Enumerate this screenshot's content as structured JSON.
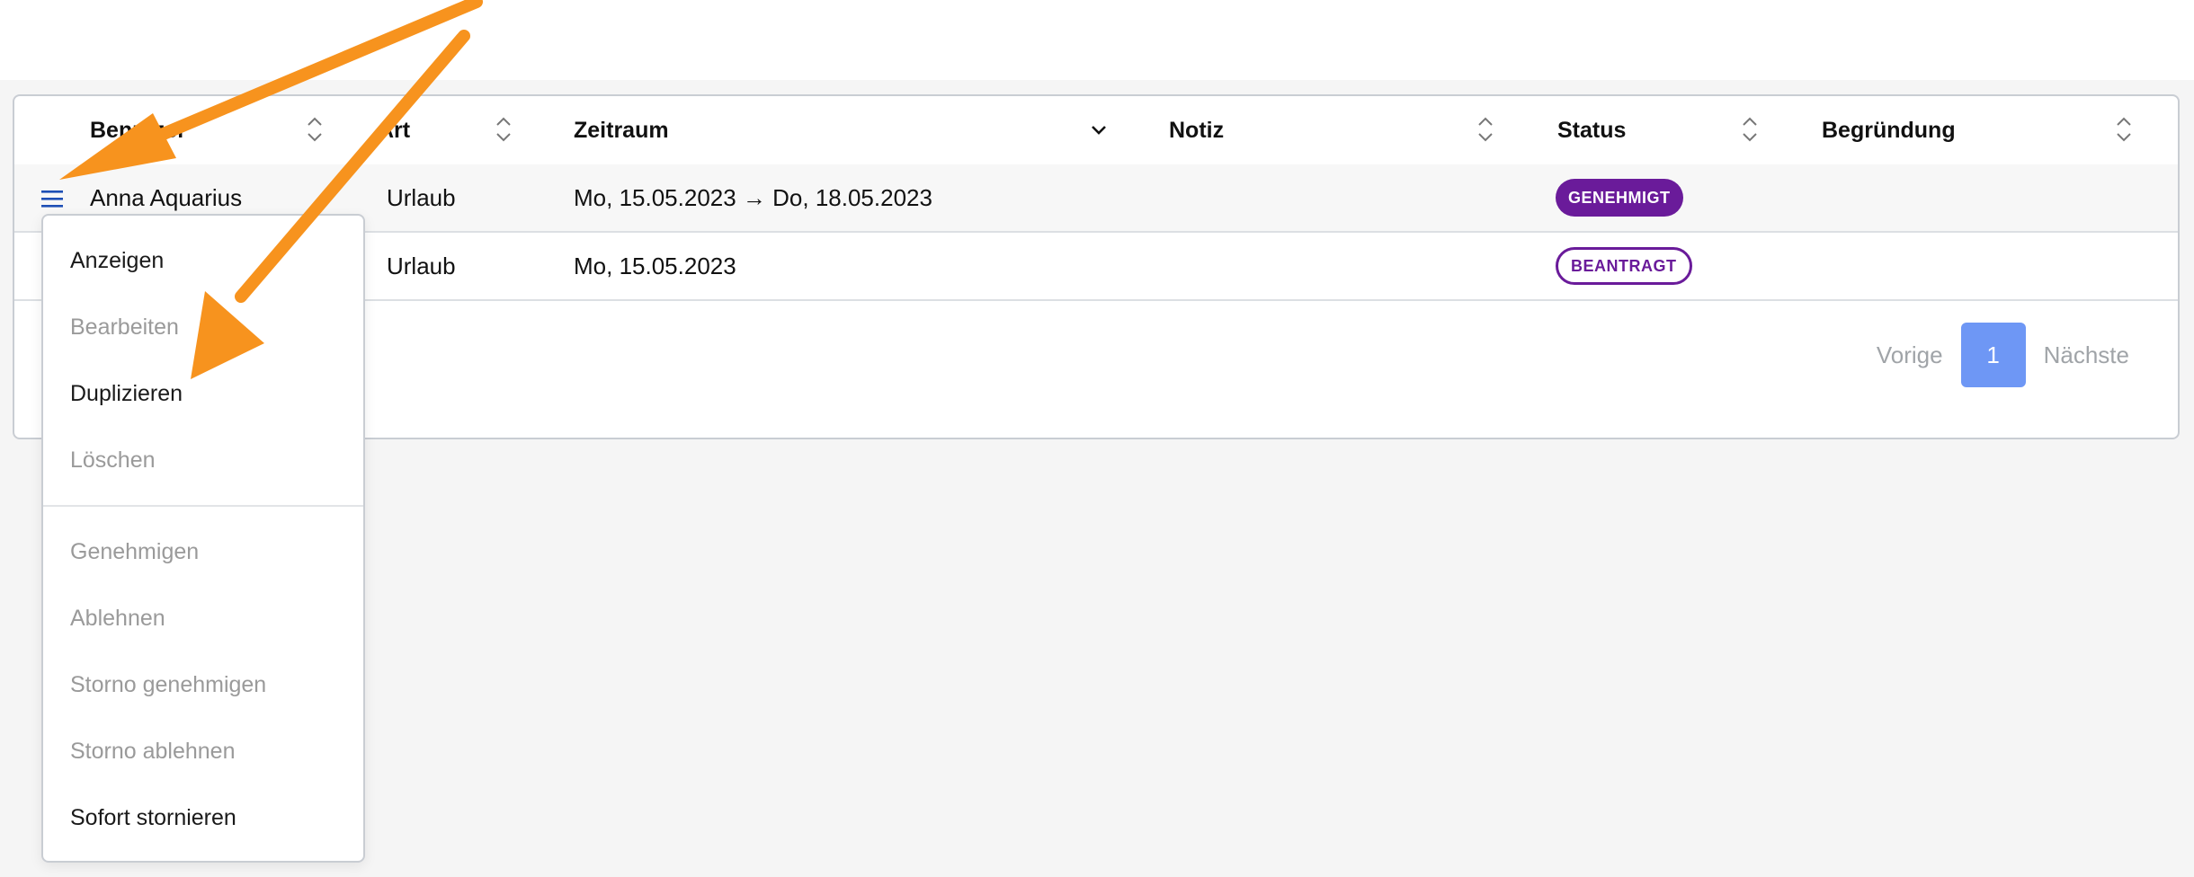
{
  "table": {
    "columns": [
      {
        "label": "Benutzer"
      },
      {
        "label": "Art"
      },
      {
        "label": "Zeitraum"
      },
      {
        "label": "Notiz"
      },
      {
        "label": "Status"
      },
      {
        "label": "Begründung"
      }
    ],
    "rows": [
      {
        "user": "Anna Aquarius",
        "art": "Urlaub",
        "zeitraum": "Mo, 15.05.2023 → Do, 18.05.2023",
        "notiz": "",
        "status": "GENEHMIGT",
        "begruendung": ""
      },
      {
        "user": "",
        "art": "Urlaub",
        "zeitraum": "Mo, 15.05.2023",
        "notiz": "",
        "status": "BEANTRAGT",
        "begruendung": ""
      }
    ]
  },
  "pagination": {
    "previous": "Vorige",
    "page": "1",
    "next": "Nächste"
  },
  "action_menu": {
    "items": [
      {
        "label": "Anzeigen",
        "enabled": true
      },
      {
        "label": "Bearbeiten",
        "enabled": false
      },
      {
        "label": "Duplizieren",
        "enabled": true
      },
      {
        "label": "Löschen",
        "enabled": false
      },
      {
        "label": "Genehmigen",
        "enabled": false
      },
      {
        "label": "Ablehnen",
        "enabled": false
      },
      {
        "label": "Storno genehmigen",
        "enabled": false
      },
      {
        "label": "Storno ablehnen",
        "enabled": false
      },
      {
        "label": "Sofort stornieren",
        "enabled": true
      }
    ]
  },
  "colors": {
    "status_genehmigt": "#6a1b9a",
    "status_beantragt": "#6a1b9a",
    "page_active": "#6e97f5",
    "annotation_arrow": "#f7931e",
    "menu_icon": "#1e4fb5"
  },
  "icons": {
    "row_menu": "hamburger-menu-icon",
    "sort": "sort-icon",
    "sort_desc": "chevron-down-icon"
  }
}
